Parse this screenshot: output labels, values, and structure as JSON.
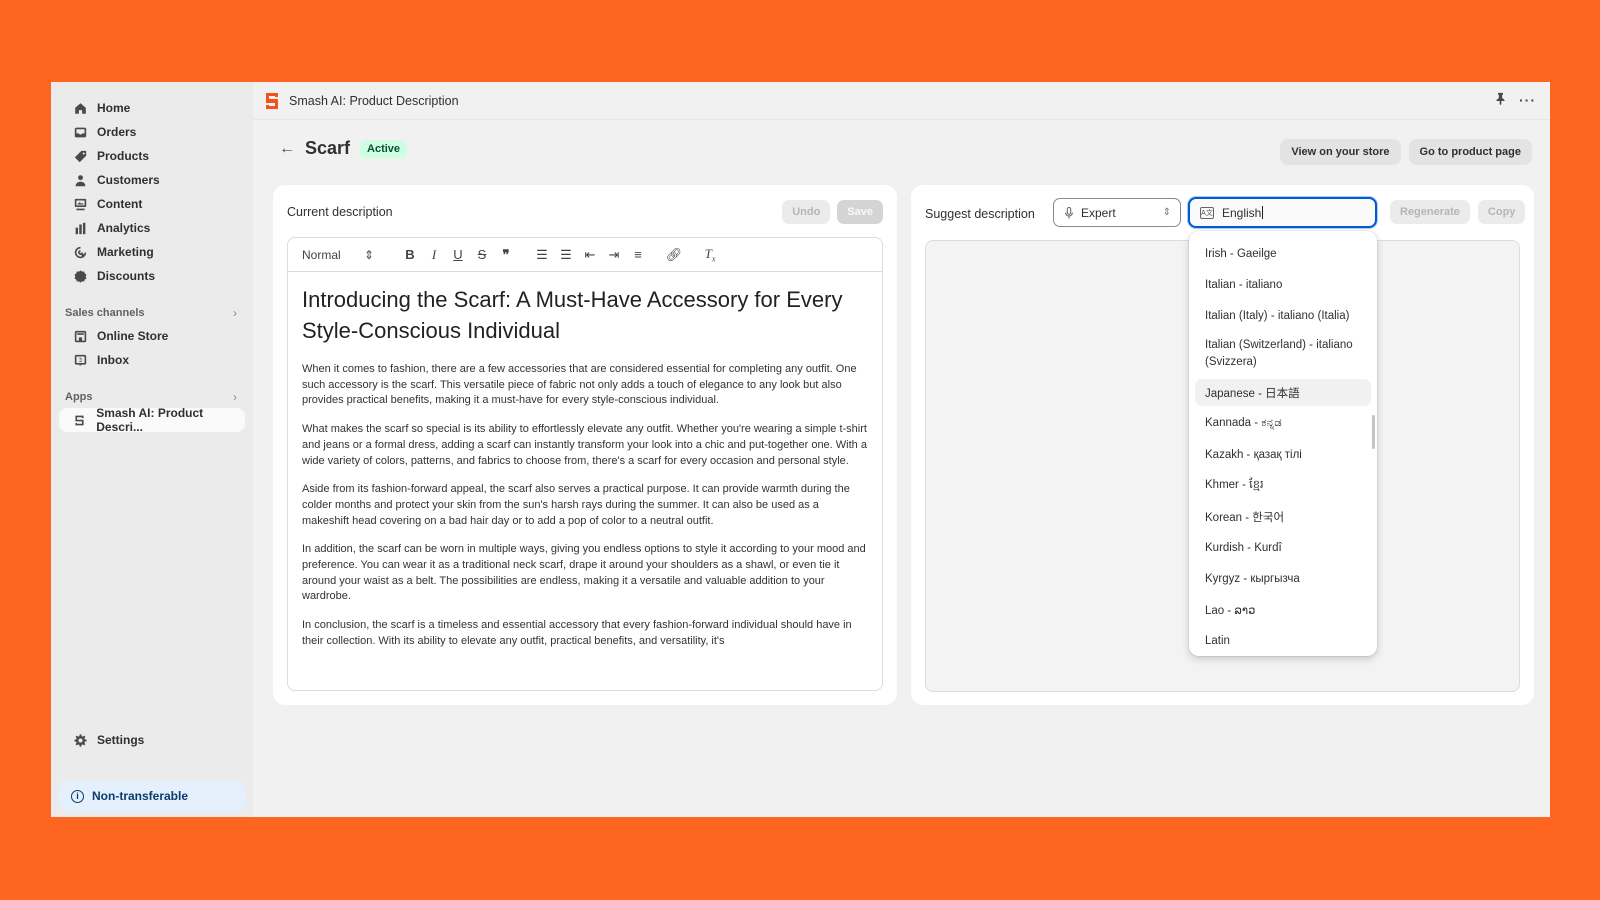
{
  "sidebar": {
    "items": [
      {
        "label": "Home",
        "icon": "home-icon"
      },
      {
        "label": "Orders",
        "icon": "inbox-tray-icon"
      },
      {
        "label": "Products",
        "icon": "tag-icon"
      },
      {
        "label": "Customers",
        "icon": "person-icon"
      },
      {
        "label": "Content",
        "icon": "image-monitor-icon"
      },
      {
        "label": "Analytics",
        "icon": "bar-chart-icon"
      },
      {
        "label": "Marketing",
        "icon": "target-icon"
      },
      {
        "label": "Discounts",
        "icon": "discount-badge-icon"
      }
    ],
    "sales_channels": {
      "label": "Sales channels",
      "items": [
        {
          "label": "Online Store",
          "icon": "storefront-icon"
        },
        {
          "label": "Inbox",
          "icon": "chat-dollar-icon"
        }
      ]
    },
    "apps": {
      "label": "Apps",
      "items": [
        {
          "label": "Smash AI: Product Descri...",
          "icon": "smash-logo-icon"
        }
      ]
    },
    "settings_label": "Settings",
    "notice_label": "Non-transferable"
  },
  "appbar": {
    "title": "Smash AI: Product Description",
    "brand_color": "#f4511e"
  },
  "page": {
    "title": "Scarf",
    "status": "Active",
    "actions": [
      "View on your store",
      "Go to product page"
    ]
  },
  "current_description": {
    "heading": "Current description",
    "undo_label": "Undo",
    "save_label": "Save",
    "toolbar": {
      "format": "Normal"
    },
    "title": "Introducing the Scarf: A Must-Have Accessory for Every Style-Conscious Individual",
    "paragraphs": [
      "When it comes to fashion, there are a few accessories that are considered essential for completing any outfit. One such accessory is the scarf. This versatile piece of fabric not only adds a touch of elegance to any look but also provides practical benefits, making it a must-have for every style-conscious individual.",
      "What makes the scarf so special is its ability to effortlessly elevate any outfit. Whether you're wearing a simple t-shirt and jeans or a formal dress, adding a scarf can instantly transform your look into a chic and put-together one. With a wide variety of colors, patterns, and fabrics to choose from, there's a scarf for every occasion and personal style.",
      "Aside from its fashion-forward appeal, the scarf also serves a practical purpose. It can provide warmth during the colder months and protect your skin from the sun's harsh rays during the summer. It can also be used as a makeshift head covering on a bad hair day or to add a pop of color to a neutral outfit.",
      "In addition, the scarf can be worn in multiple ways, giving you endless options to style it according to your mood and preference. You can wear it as a traditional neck scarf, drape it around your shoulders as a shawl, or even tie it around your waist as a belt. The possibilities are endless, making it a versatile and valuable addition to your wardrobe.",
      "In conclusion, the scarf is a timeless and essential accessory that every fashion-forward individual should have in their collection. With its ability to elevate any outfit, practical benefits, and versatility, it's"
    ]
  },
  "suggest": {
    "heading": "Suggest description",
    "tone_value": "Expert",
    "language_value": "English",
    "regenerate_label": "Regenerate",
    "copy_label": "Copy",
    "language_options": [
      "Irish - Gaeilge",
      "Italian - italiano",
      "Italian (Italy) - italiano (Italia)",
      "Italian (Switzerland) - italiano (Svizzera)",
      "Japanese - 日本語",
      "Kannada - ಕನ್ನಡ",
      "Kazakh - қазақ тілі",
      "Khmer - ខ្មែរ",
      "Korean - 한국어",
      "Kurdish - Kurdî",
      "Kyrgyz - кыргызча",
      "Lao - ລາວ",
      "Latin"
    ],
    "highlighted_option": "Japanese - 日本語"
  }
}
